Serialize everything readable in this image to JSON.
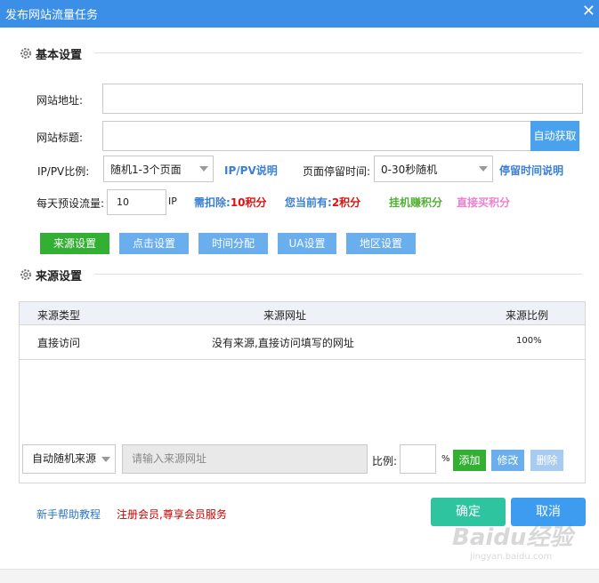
{
  "window": {
    "title": "发布网站流量任务",
    "close_glyph": "✕"
  },
  "basic": {
    "section_label": "基本设置",
    "site_url_label": "网站地址:",
    "site_url_value": "",
    "site_title_label": "网站标题:",
    "site_title_value": "",
    "auto_fetch_label": "自动获取",
    "ippv_label": "IP/PV比例:",
    "ippv_selected": "随机1-3个页面",
    "ippv_help": "IP/PV说明",
    "stay_label": "页面停留时间:",
    "stay_selected": "0-30秒随机",
    "stay_help": "停留时间说明",
    "daily_label": "每天预设流量:",
    "daily_value": "10",
    "daily_unit": "IP",
    "deduct_label": "需扣除:",
    "deduct_value": "10积分",
    "current_label": "您当前有:",
    "current_value": "2积分",
    "earn_link": "挂机赚积分",
    "buy_link": "直接买积分"
  },
  "tabs": [
    "来源设置",
    "点击设置",
    "时间分配",
    "UA设置",
    "地区设置"
  ],
  "source": {
    "section_label": "来源设置",
    "columns": [
      "来源类型",
      "来源网址",
      "来源比例"
    ],
    "rows": [
      {
        "type": "直接访问",
        "url": "没有来源,直接访问填写的网址",
        "ratio": "100%"
      }
    ],
    "type_select": "自动随机来源",
    "url_placeholder": "请输入来源网址",
    "ratio_label": "比例:",
    "ratio_value": "",
    "percent": "%",
    "add_label": "添加",
    "edit_label": "修改",
    "delete_label": "删除"
  },
  "footer": {
    "help_link": "新手帮助教程",
    "register_link": "注册会员,尊享会员服务",
    "ok_label": "确定",
    "cancel_label": "取消"
  },
  "watermark": {
    "main": "Baidu经验",
    "sub": "jingyan.baidu.com"
  },
  "colors": {
    "titlebar": "#3c8fe6",
    "tab_active": "#33b033",
    "tab_inactive": "#6aaeee",
    "ok": "#2ec4a0",
    "cancel": "#3d9cf0",
    "red_link": "#cc0000",
    "green_link": "#52b035",
    "pink_link": "#f07fd0"
  }
}
